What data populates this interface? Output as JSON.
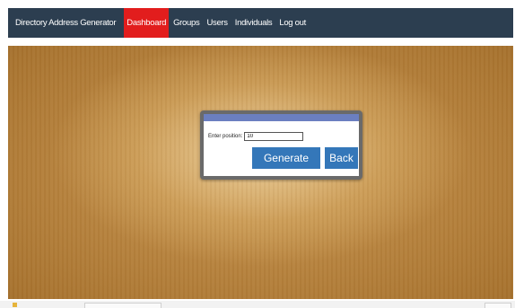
{
  "navbar": {
    "brand": "Directory Address Generator",
    "items": [
      {
        "label": "Dashboard",
        "active": true
      },
      {
        "label": "Groups",
        "active": false
      },
      {
        "label": "Users",
        "active": false
      },
      {
        "label": "Individuals",
        "active": false
      },
      {
        "label": "Log out",
        "active": false
      }
    ],
    "active_color": "#e21d1d",
    "bar_color": "#2c3e50"
  },
  "dialog": {
    "position_label": "Enter position:",
    "position_value": "10",
    "generate_label": "Generate",
    "back_label": "Back",
    "header_color": "#6b7fc0",
    "button_color": "#3477b9"
  }
}
